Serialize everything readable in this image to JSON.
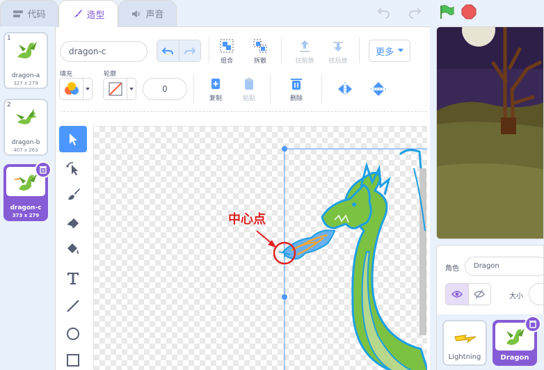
{
  "tabs": [
    {
      "label": "代码"
    },
    {
      "label": "造型"
    },
    {
      "label": "声音"
    }
  ],
  "costumes": [
    {
      "number": "1",
      "name": "dragon-a",
      "size": "327 x 279"
    },
    {
      "number": "2",
      "name": "dragon-b",
      "size": "407 x 263"
    },
    {
      "number": "3",
      "name": "dragon-c",
      "size": "373 x 279"
    }
  ],
  "editor": {
    "costume_name": "dragon-c",
    "fill_label": "填充",
    "outline_label": "轮廓",
    "outline_width": "0",
    "group_label": "组合",
    "ungroup_label": "拆散",
    "forward_label": "往前放",
    "backward_label": "往后放",
    "more_label": "更多",
    "copy_label": "复制",
    "paste_label": "粘贴",
    "delete_label": "删除"
  },
  "annotation": {
    "text": "中心点",
    "color": "#e02020"
  },
  "sprite_info": {
    "sprite_label": "角色",
    "sprite_name": "Dragon",
    "size_label": "大小"
  },
  "sprites": [
    {
      "name": "Lightning"
    },
    {
      "name": "Dragon"
    }
  ],
  "colors": {
    "accent": "#855cd6",
    "blue": "#4c97ff",
    "dragon_green": "#7cc242",
    "outline_blue": "#1e9fe3"
  }
}
